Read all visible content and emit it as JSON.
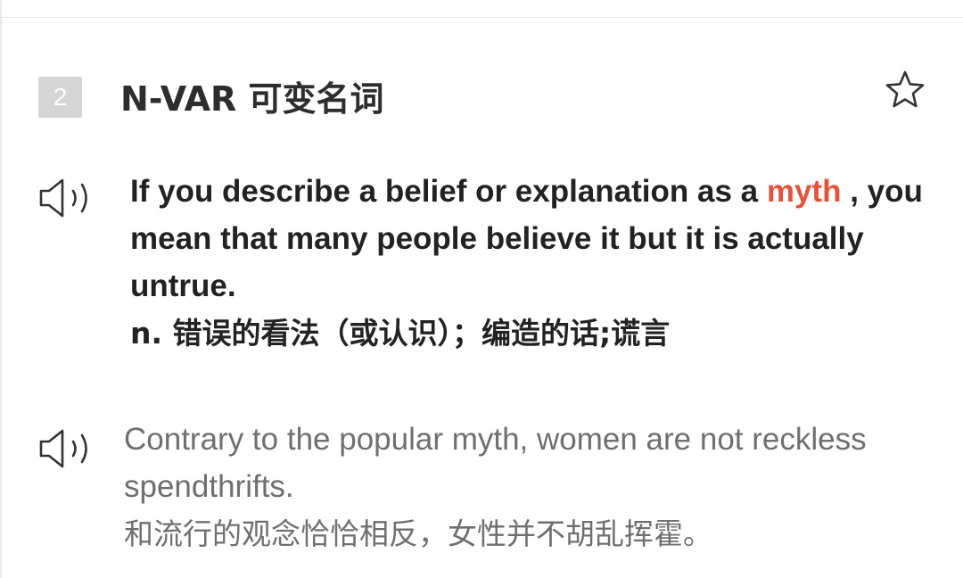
{
  "entry": {
    "sense_number": "2",
    "pos_label": "N-VAR 可变名词",
    "definition": {
      "before_keyword": "If you describe a belief or explanation as a ",
      "keyword": "myth",
      "after_keyword": " , you mean that many people believe it but it is actually untrue.",
      "translation": "n. 错误的看法（或认识）；编造的话;谎言"
    },
    "example": {
      "sentence": "Contrary to the popular myth, women are not reckless spendthrifts.",
      "translation": "和流行的观念恰恰相反，女性并不胡乱挥霍。"
    }
  },
  "icons": {
    "star": "star-outline-icon",
    "speaker": "speaker-icon"
  },
  "colors": {
    "keyword": "#e4543d",
    "badge_bg": "#d5d5d5",
    "definition_text": "#222222",
    "example_text": "#6f6f6f"
  }
}
